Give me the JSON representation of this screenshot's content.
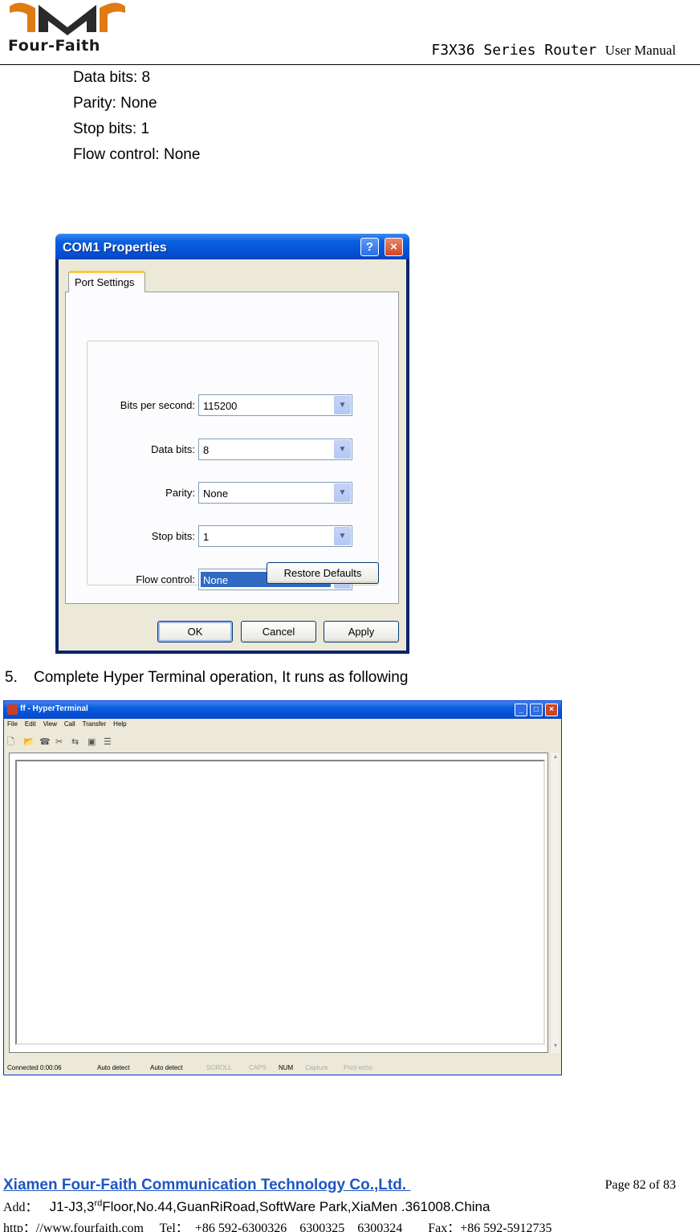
{
  "header": {
    "logo_text": "Four-Faith",
    "model": "F3X36 Series Router",
    "manual": "User Manual"
  },
  "settings": [
    "Data bits: 8",
    "Parity: None",
    "Stop bits: 1",
    "Flow control: None"
  ],
  "com1_dialog": {
    "title": "COM1 Properties",
    "help_glyph": "?",
    "close_glyph": "×",
    "tab": "Port Settings",
    "fields": [
      {
        "label": "Bits per second:",
        "value": "115200"
      },
      {
        "label": "Data bits:",
        "value": "8"
      },
      {
        "label": "Parity:",
        "value": "None"
      },
      {
        "label": "Stop bits:",
        "value": "1"
      },
      {
        "label": "Flow control:",
        "value": "None"
      }
    ],
    "restore_defaults": "Restore Defaults",
    "ok": "OK",
    "cancel": "Cancel",
    "apply": "Apply"
  },
  "step": {
    "number": "5.",
    "text": "Complete Hyper Terminal operation, It runs as following"
  },
  "hyperterminal": {
    "title": "ff - HyperTerminal",
    "menu": [
      "File",
      "Edit",
      "View",
      "Call",
      "Transfer",
      "Help"
    ],
    "status": {
      "connected": "Connected 0:00:06",
      "detect1": "Auto detect",
      "detect2": "Auto detect",
      "scroll": "SCROLL",
      "caps": "CAPS",
      "num": "NUM",
      "capture": "Capture",
      "print_echo": "Print echo"
    }
  },
  "footer": {
    "company": "Xiamen Four-Faith Communication Technology Co.,Ltd. ",
    "page": "Page 82 of 83",
    "addr_label": "Add：",
    "addr_pre": "   J1-J3,3",
    "addr_sup": "rd",
    "addr_post": "Floor,No.44,GuanRiRoad,SoftWare Park,XiaMen .361008.China",
    "contact": "http：//www.fourfaith.com     Tel：  +86 592-6300326    6300325    6300324        Fax：+86 592-5912735"
  }
}
